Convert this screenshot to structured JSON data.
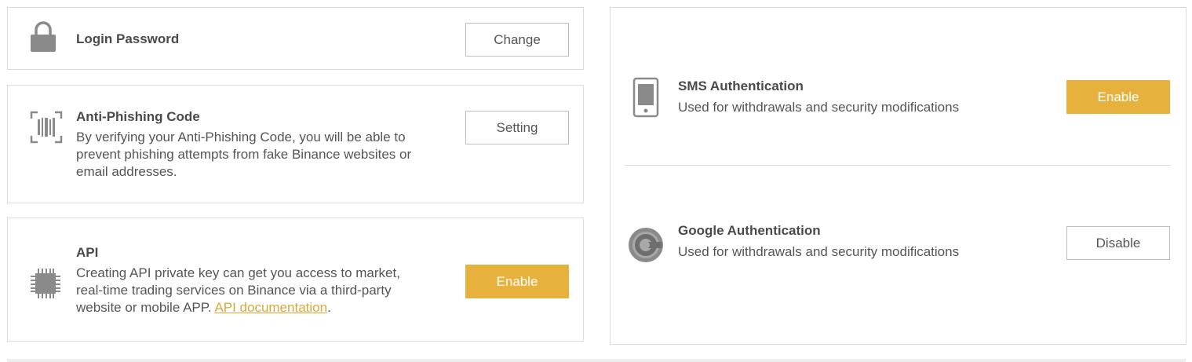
{
  "login_password": {
    "icon": "padlock-icon",
    "title": "Login Password",
    "button": "Change"
  },
  "anti_phishing": {
    "icon": "barcode-scan-icon",
    "title": "Anti-Phishing Code",
    "desc_line1": "By verifying your Anti-Phishing Code, you will be able to",
    "desc_line2": "prevent phishing attempts from fake Binance websites or",
    "desc_line3": "email addresses.",
    "button": "Setting"
  },
  "api": {
    "icon": "chip-icon",
    "title": "API",
    "desc_line1": "Creating API private key can get you access to market,",
    "desc_line2": "real-time trading services on Binance via a third-party",
    "desc_line3_prefix": "website or mobile APP. ",
    "desc_link": "API documentation",
    "desc_line3_suffix": ".",
    "button": "Enable"
  },
  "sms_auth": {
    "icon": "mobile-phone-icon",
    "title": "SMS Authentication",
    "desc": "Used for withdrawals and security modifications",
    "button": "Enable"
  },
  "google_auth": {
    "icon": "google-authenticator-icon",
    "title": "Google Authentication",
    "desc": "Used for withdrawals and security modifications",
    "button": "Disable"
  },
  "colors": {
    "accent": "#e7b13e",
    "link": "#d9a93a",
    "border": "#dcdcdc",
    "text": "#555555"
  }
}
